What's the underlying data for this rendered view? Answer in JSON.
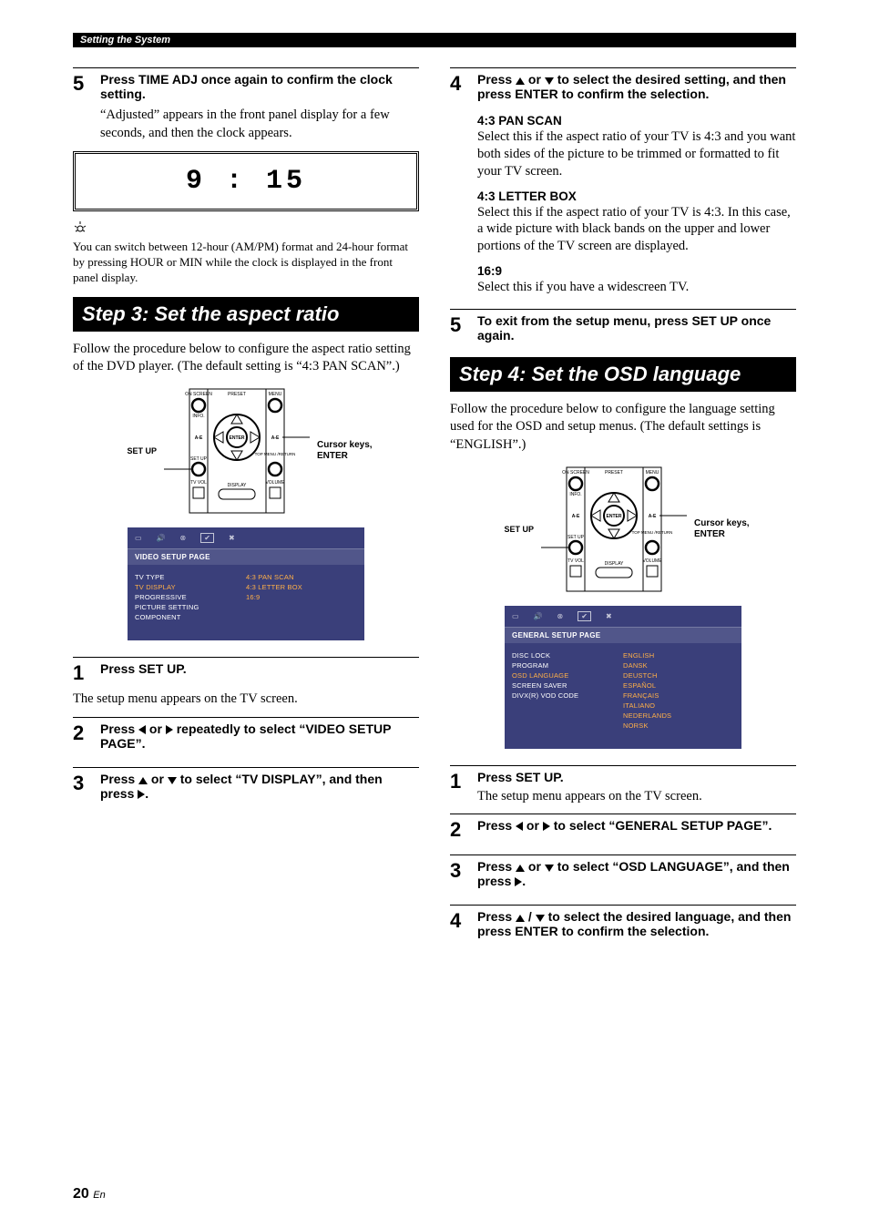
{
  "header": "Setting the System",
  "page_number": "20",
  "page_suffix": "En",
  "left": {
    "step5": {
      "num": "5",
      "title": "Press TIME ADJ once again to confirm the clock setting.",
      "body": "“Adjusted” appears in the front panel display for a few seconds, and then the clock appears."
    },
    "display": "9 : 15",
    "tip": "You can switch between 12-hour (AM/PM) format and 24-hour format by pressing HOUR or MIN while the clock is displayed in the front panel display.",
    "section": "Step 3: Set the aspect ratio",
    "intro": "Follow the procedure below to configure the aspect ratio setting of the DVD player. (The default setting is “4:3 PAN SCAN”.)",
    "remote": {
      "left_label": "SET UP",
      "right_label": "Cursor keys, ENTER",
      "labels": {
        "onscreen": "ON SCREEN",
        "preset": "PRESET",
        "menu": "MENU",
        "info": "INFO.",
        "ae": "A-E",
        "enter": "ENTER",
        "topmenu": "TOP MENU /RETURN",
        "setup": "SET UP",
        "tvvol": "TV VOL",
        "display": "DISPLAY",
        "volume": "VOLUME"
      }
    },
    "osd": {
      "title": "VIDEO SETUP PAGE",
      "left_items": [
        "TV TYPE",
        "TV DISPLAY",
        "PROGRESSIVE",
        "PICTURE SETTING",
        "COMPONENT"
      ],
      "left_sel_index": 1,
      "right_items": [
        "4:3 PAN SCAN",
        "4:3 LETTER BOX",
        "16:9"
      ]
    },
    "s1": {
      "num": "1",
      "title": "Press SET UP.",
      "body": "The setup menu appears on the TV screen."
    },
    "s2": {
      "num": "2",
      "t1": "Press ",
      "t2": " or ",
      "t3": " repeatedly to select “VIDEO SETUP PAGE”."
    },
    "s3": {
      "num": "3",
      "t1": "Press ",
      "t2": " or ",
      "t3": " to select “TV DISPLAY”, and then press ",
      "t4": "."
    }
  },
  "right": {
    "s4": {
      "num": "4",
      "t1": "Press ",
      "t2": " or ",
      "t3": " to select the desired setting, and then press ENTER to confirm the selection."
    },
    "opt1": {
      "h": "4:3 PAN SCAN",
      "p": "Select this if the aspect ratio of your TV is 4:3 and you want both sides of the picture to be trimmed or formatted to fit your TV screen."
    },
    "opt2": {
      "h": "4:3 LETTER BOX",
      "p": "Select this if the aspect ratio of your TV is 4:3. In this case, a wide picture with black bands on the upper and lower portions of the TV screen are displayed."
    },
    "opt3": {
      "h": "16:9",
      "p": "Select this if you have a widescreen TV."
    },
    "s5": {
      "num": "5",
      "title": "To exit from the setup menu, press SET UP once again."
    },
    "section": "Step 4: Set the OSD language",
    "intro": "Follow the procedure below to configure the language setting used for the OSD and setup menus. (The default settings is “ENGLISH”.)",
    "remote": {
      "left_label": "SET UP",
      "right_label": "Cursor keys, ENTER"
    },
    "osd": {
      "title": "GENERAL SETUP PAGE",
      "left_items": [
        "DISC LOCK",
        "PROGRAM",
        "OSD LANGUAGE",
        "SCREEN SAVER",
        "DIVX(R) VOD CODE"
      ],
      "left_sel_index": 2,
      "right_items": [
        "ENGLISH",
        "DANSK",
        "DEUSTCH",
        "ESPAÑOL",
        "FRANÇAIS",
        "ITALIANO",
        "NEDERLANDS",
        "NORSK"
      ]
    },
    "r1": {
      "num": "1",
      "title": "Press SET UP.",
      "body": "The setup menu appears on the TV screen."
    },
    "r2": {
      "num": "2",
      "t1": "Press ",
      "t2": " or ",
      "t3": " to select “GENERAL SETUP PAGE”."
    },
    "r3": {
      "num": "3",
      "t1": "Press ",
      "t2": " or ",
      "t3": " to select “OSD LANGUAGE”, and then press ",
      "t4": "."
    },
    "r4": {
      "num": "4",
      "t1": "Press ",
      "t2": " / ",
      "t3": " to select the desired language, and then press ENTER to confirm the selection."
    }
  }
}
